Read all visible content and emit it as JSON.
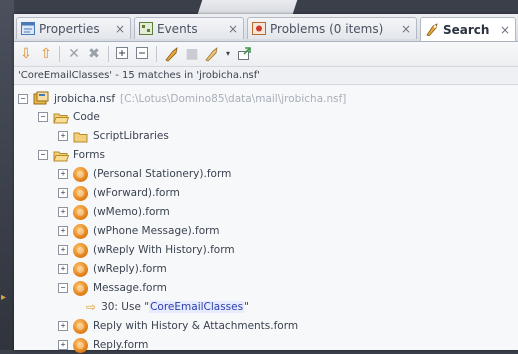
{
  "tabs": [
    {
      "label": "Properties",
      "close": "×"
    },
    {
      "label": "Events",
      "close": "×"
    },
    {
      "label": "Problems (0 items)",
      "close": "×"
    },
    {
      "label": "Search",
      "close": "×"
    }
  ],
  "status_line": "'CoreEmailClasses' - 15 matches in 'jrobicha.nsf'",
  "tree": {
    "root": {
      "name": "jrobicha.nsf",
      "path": "[C:\\Lotus\\Domino85\\data\\mail\\jrobicha.nsf]"
    },
    "code_folder": "Code",
    "script_libraries": "ScriptLibraries",
    "forms_folder": "Forms",
    "forms": [
      "(Personal Stationery).form",
      "(wForward).form",
      "(wMemo).form",
      "(wPhone Message).form",
      "(wReply With History).form",
      "(wReply).form",
      "Message.form"
    ],
    "match": {
      "prefix": "30: Use \"",
      "term": "CoreEmailClasses",
      "suffix": "\""
    },
    "more_forms": [
      "Reply with History & Attachments.form",
      "Reply.form"
    ]
  },
  "expander": {
    "open": "−",
    "closed": "+"
  },
  "colors": {
    "accent": "#e07a12",
    "folder": "#e8b64a",
    "highlight_text": "#2d3fa8"
  }
}
